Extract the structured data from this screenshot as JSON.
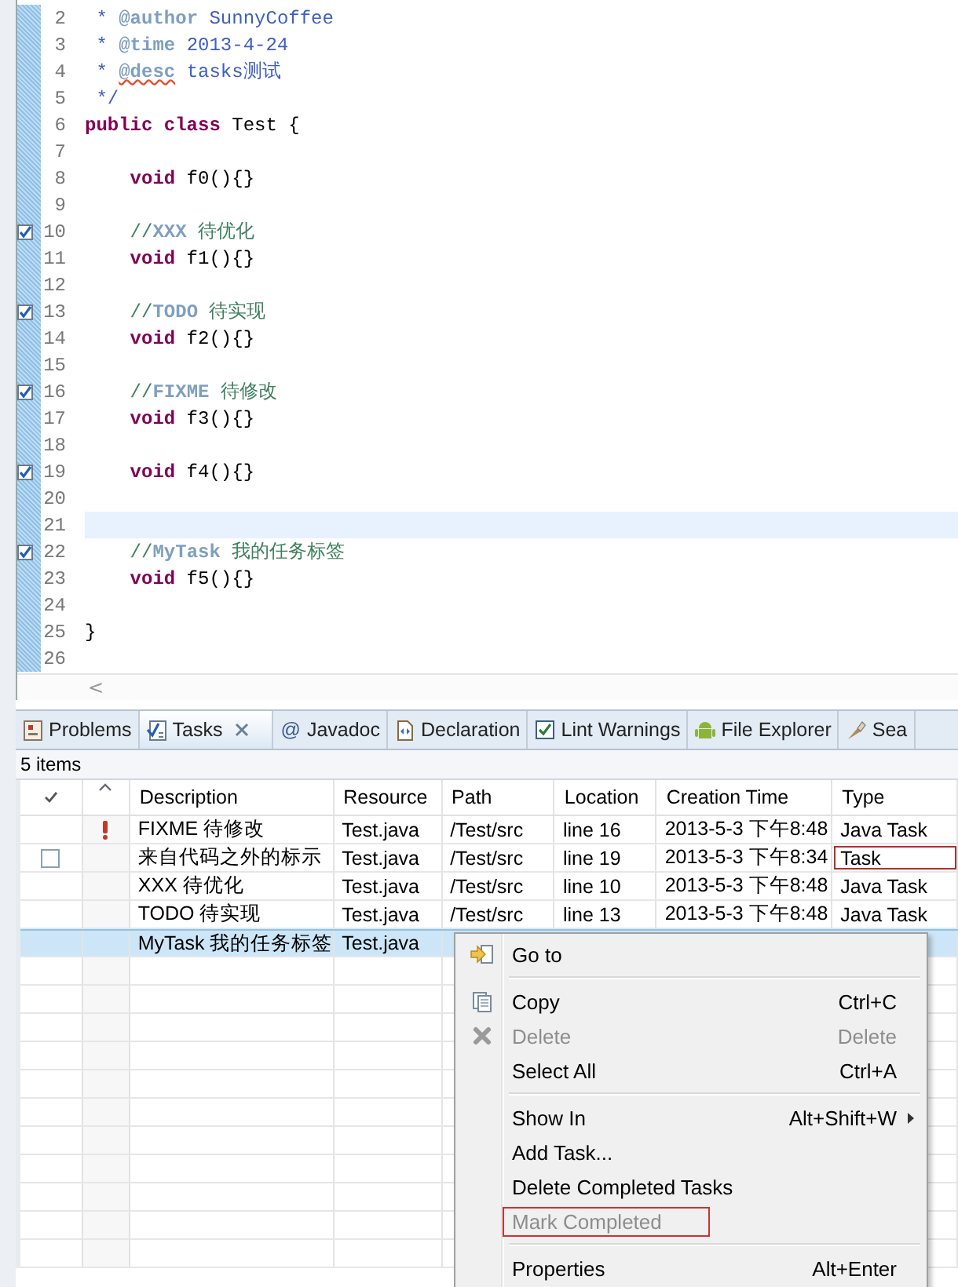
{
  "editor": {
    "lines": [
      {
        "number": "2",
        "task": false,
        "current": false,
        "segments": [
          {
            "kind": "doc",
            "text": " * "
          },
          {
            "kind": "doctag",
            "text": "@author"
          },
          {
            "kind": "doc",
            "text": " SunnyCoffee"
          }
        ]
      },
      {
        "number": "3",
        "task": false,
        "current": false,
        "segments": [
          {
            "kind": "doc",
            "text": " * "
          },
          {
            "kind": "doctag",
            "text": "@time"
          },
          {
            "kind": "doc",
            "text": " 2013-4-24"
          }
        ]
      },
      {
        "number": "4",
        "task": false,
        "current": false,
        "segments": [
          {
            "kind": "doc",
            "text": " * "
          },
          {
            "kind": "doctag-misspelled",
            "text": "@desc"
          },
          {
            "kind": "doc",
            "text": " tasks测试"
          }
        ]
      },
      {
        "number": "5",
        "task": false,
        "current": false,
        "segments": [
          {
            "kind": "doc",
            "text": " */"
          }
        ]
      },
      {
        "number": "6",
        "task": false,
        "current": false,
        "segments": [
          {
            "kind": "keyword",
            "text": "public class"
          },
          {
            "kind": "plain",
            "text": " Test {"
          }
        ]
      },
      {
        "number": "7",
        "task": false,
        "current": false
      },
      {
        "number": "8",
        "task": false,
        "current": false,
        "segments": [
          {
            "kind": "keyword",
            "text": "    void"
          },
          {
            "kind": "plain",
            "text": " f0(){}"
          }
        ]
      },
      {
        "number": "9",
        "task": false,
        "current": false
      },
      {
        "number": "10",
        "task": true,
        "current": false,
        "segments": [
          {
            "kind": "comment",
            "text": "    //"
          },
          {
            "kind": "tasktag",
            "text": "XXX"
          },
          {
            "kind": "comment",
            "text": " 待优化"
          }
        ]
      },
      {
        "number": "11",
        "task": false,
        "current": false,
        "segments": [
          {
            "kind": "keyword",
            "text": "    void"
          },
          {
            "kind": "plain",
            "text": " f1(){}"
          }
        ]
      },
      {
        "number": "12",
        "task": false,
        "current": false
      },
      {
        "number": "13",
        "task": true,
        "current": false,
        "segments": [
          {
            "kind": "comment",
            "text": "    //"
          },
          {
            "kind": "tasktag",
            "text": "TODO"
          },
          {
            "kind": "comment",
            "text": " 待实现"
          }
        ]
      },
      {
        "number": "14",
        "task": false,
        "current": false,
        "segments": [
          {
            "kind": "keyword",
            "text": "    void"
          },
          {
            "kind": "plain",
            "text": " f2(){}"
          }
        ]
      },
      {
        "number": "15",
        "task": false,
        "current": false
      },
      {
        "number": "16",
        "task": true,
        "current": false,
        "segments": [
          {
            "kind": "comment",
            "text": "    //"
          },
          {
            "kind": "tasktag",
            "text": "FIXME"
          },
          {
            "kind": "comment",
            "text": " 待修改"
          }
        ]
      },
      {
        "number": "17",
        "task": false,
        "current": false,
        "segments": [
          {
            "kind": "keyword",
            "text": "    void"
          },
          {
            "kind": "plain",
            "text": " f3(){}"
          }
        ]
      },
      {
        "number": "18",
        "task": false,
        "current": false
      },
      {
        "number": "19",
        "task": true,
        "current": false,
        "segments": [
          {
            "kind": "keyword",
            "text": "    void"
          },
          {
            "kind": "plain",
            "text": " f4(){}"
          }
        ]
      },
      {
        "number": "20",
        "task": false,
        "current": false
      },
      {
        "number": "21",
        "task": false,
        "current": true
      },
      {
        "number": "22",
        "task": true,
        "current": false,
        "segments": [
          {
            "kind": "comment",
            "text": "    //"
          },
          {
            "kind": "tasktag",
            "text": "MyTask"
          },
          {
            "kind": "comment",
            "text": " 我的任务标签"
          }
        ]
      },
      {
        "number": "23",
        "task": false,
        "current": false,
        "segments": [
          {
            "kind": "keyword",
            "text": "    void"
          },
          {
            "kind": "plain",
            "text": " f5(){}"
          }
        ]
      },
      {
        "number": "24",
        "task": false,
        "current": false
      },
      {
        "number": "25",
        "task": false,
        "current": false,
        "segments": [
          {
            "kind": "plain",
            "text": "}"
          }
        ]
      },
      {
        "number": "26",
        "task": false,
        "current": false
      }
    ],
    "scroll_left": "<"
  },
  "tabs": [
    {
      "label": "Problems",
      "selected": false,
      "closable": false
    },
    {
      "label": "Tasks",
      "selected": true,
      "closable": true
    },
    {
      "label": "Javadoc",
      "glyph": "@",
      "selected": false,
      "closable": false
    },
    {
      "label": "Declaration",
      "selected": false,
      "closable": false
    },
    {
      "label": "Lint Warnings",
      "selected": false,
      "closable": false
    },
    {
      "label": "File Explorer",
      "selected": false,
      "closable": false
    },
    {
      "label": "Sea",
      "selected": false,
      "closable": false
    }
  ],
  "tasks": {
    "count": "5 items",
    "columns": [
      {
        "kind": "done"
      },
      {
        "kind": "priority",
        "sorted": true
      },
      {
        "kind": "text",
        "label": "Description"
      },
      {
        "kind": "text",
        "label": "Resource"
      },
      {
        "kind": "text",
        "label": "Path"
      },
      {
        "kind": "text",
        "label": "Location"
      },
      {
        "kind": "text",
        "label": "Creation Time"
      },
      {
        "kind": "text",
        "label": "Type"
      }
    ],
    "rows": [
      {
        "selected": false,
        "high_priority": true,
        "description": "FIXME 待修改",
        "resource": "Test.java",
        "path": "/Test/src",
        "location": "line 16",
        "created": "2013-5-3 下午8:48",
        "type": "Java Task",
        "type_outlined": false
      },
      {
        "selected": false,
        "high_priority": false,
        "checkbox": {
          "checked": false
        },
        "description": "来自代码之外的标示",
        "resource": "Test.java",
        "path": "/Test/src",
        "location": "line 19",
        "created": "2013-5-3 下午8:34",
        "type": "Task",
        "type_outlined": true
      },
      {
        "selected": false,
        "high_priority": false,
        "description": "XXX 待优化",
        "resource": "Test.java",
        "path": "/Test/src",
        "location": "line 10",
        "created": "2013-5-3 下午8:48",
        "type": "Java Task",
        "type_outlined": false
      },
      {
        "selected": false,
        "high_priority": false,
        "description": "TODO 待实现",
        "resource": "Test.java",
        "path": "/Test/src",
        "location": "line 13",
        "created": "2013-5-3 下午8:48",
        "type": "Java Task",
        "type_outlined": false
      },
      {
        "selected": true,
        "high_priority": false,
        "description": "MyTask 我的任务标签",
        "resource": "Test.java"
      }
    ]
  },
  "context_menu": [
    {
      "kind": "item",
      "label": "Go to",
      "disabled": false,
      "outlined": false
    },
    {
      "kind": "separator"
    },
    {
      "kind": "item",
      "label": "Copy",
      "shortcut": "Ctrl+C",
      "disabled": false,
      "outlined": false
    },
    {
      "kind": "item",
      "label": "Delete",
      "shortcut": "Delete",
      "disabled": true,
      "outlined": false
    },
    {
      "kind": "item",
      "label": "Select All",
      "shortcut": "Ctrl+A",
      "disabled": false,
      "outlined": false
    },
    {
      "kind": "separator"
    },
    {
      "kind": "item",
      "label": "Show In",
      "shortcut": "Alt+Shift+W",
      "submenu": true,
      "disabled": false,
      "outlined": false
    },
    {
      "kind": "item",
      "label": "Add Task...",
      "disabled": false,
      "outlined": false
    },
    {
      "kind": "item",
      "label": "Delete Completed Tasks",
      "disabled": false,
      "outlined": false
    },
    {
      "kind": "item",
      "label": "Mark Completed",
      "disabled": true,
      "outlined": true
    },
    {
      "kind": "separator"
    },
    {
      "kind": "item",
      "label": "Properties",
      "shortcut": "Alt+Enter",
      "disabled": false,
      "outlined": false
    }
  ]
}
